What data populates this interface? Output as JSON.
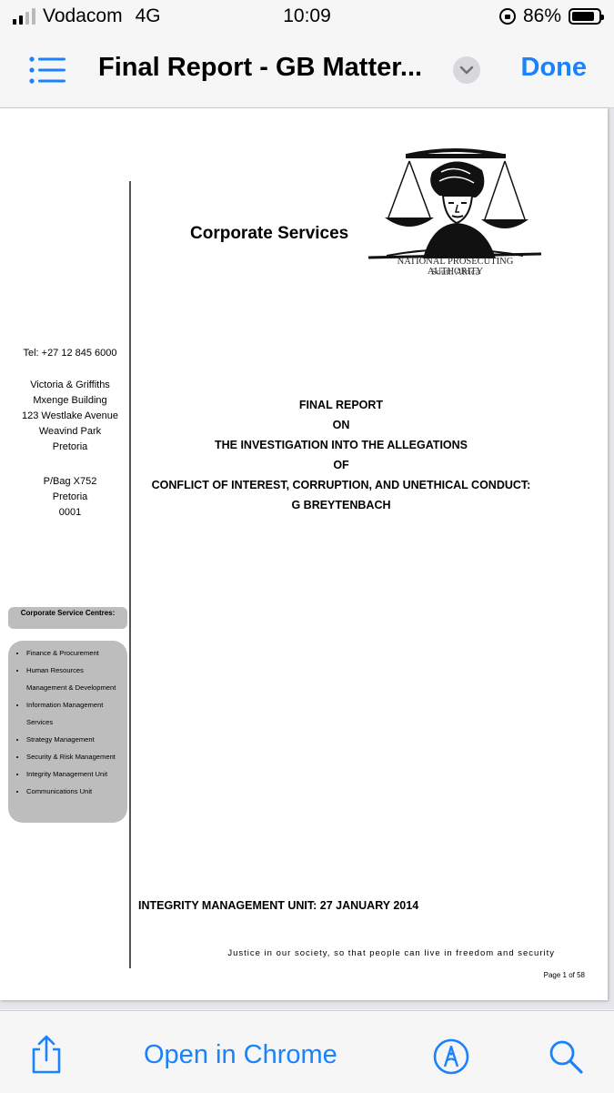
{
  "status": {
    "carrier": "Vodacom",
    "network": "4G",
    "time": "10:09",
    "battery": "86%",
    "battery_level": 0.86,
    "signal_bars": 4,
    "signal_filled": 2
  },
  "nav": {
    "title": "Final Report - GB Matter...",
    "done_label": "Done",
    "list_icon": "list-icon",
    "chevron_icon": "chevron-down-icon"
  },
  "document": {
    "header_title": "Corporate Services",
    "logo_name": "NATIONAL PROSECUTING AUTHORITY",
    "logo_country": "South Africa",
    "tel": "Tel: +27 12 845 6000",
    "address": [
      "Victoria & Griffiths",
      "Mxenge Building",
      "123 Westlake Avenue",
      "Weavind Park",
      "Pretoria"
    ],
    "postal": [
      "P/Bag X752",
      "Pretoria",
      "0001"
    ],
    "centres_heading": "Corporate Service Centres:",
    "centres": [
      "Finance & Procurement",
      "Human Resources",
      "Management & Development",
      "Information Management",
      "Services",
      "Strategy Management",
      "Security & Risk Management",
      "Integrity Management Unit",
      "Communications Unit"
    ],
    "report_title_lines": [
      "FINAL REPORT",
      "ON",
      "THE INVESTIGATION INTO THE ALLEGATIONS",
      "OF",
      "CONFLICT OF INTEREST, CORRUPTION, AND UNETHICAL CONDUCT:",
      "G BREYTENBACH"
    ],
    "unit_date": "INTEGRITY MANAGEMENT UNIT: 27 JANUARY 2014",
    "motto": "Justice in our society, so that people can live in freedom and security",
    "page_number": "Page 1 of 58"
  },
  "toolbar": {
    "open_in_label": "Open in Chrome",
    "share_icon": "share-icon",
    "markup_icon": "markup-icon",
    "search_icon": "search-icon"
  },
  "colors": {
    "accent": "#1a82fb",
    "bar_background": "#f6f6f6",
    "centres_box": "#bdbdbd"
  }
}
